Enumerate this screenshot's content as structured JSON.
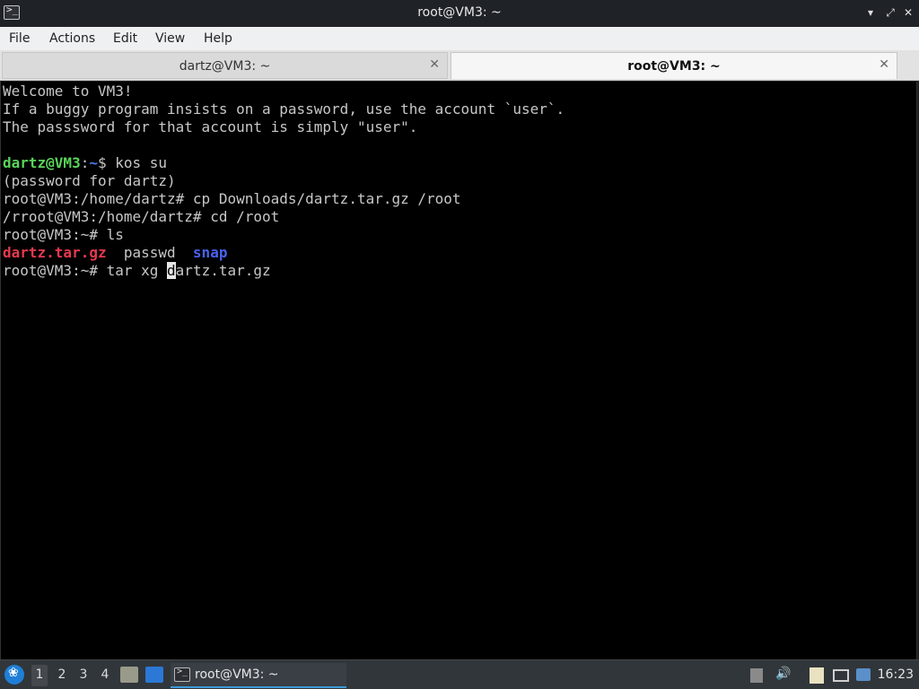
{
  "window": {
    "title": "root@VM3: ~",
    "icon": "terminal-icon",
    "controls": [
      "minimize-icon",
      "maximize-icon",
      "close-icon"
    ]
  },
  "menu": {
    "file": "File",
    "actions": "Actions",
    "edit": "Edit",
    "view": "View",
    "help": "Help"
  },
  "tabs": [
    {
      "label": "dartz@VM3: ~",
      "active": false
    },
    {
      "label": "root@VM3: ~",
      "active": true
    }
  ],
  "terminal": {
    "l1": "Welcome to VM3!",
    "l2": "If a buggy program insists on a password, use the account `user`.",
    "l3": "The passsword for that account is simply \"user\".",
    "l5_user": "dartz@VM3",
    "l5_colon": ":",
    "l5_path": "~",
    "l5_cmd": "$ kos su",
    "l6": "(password for dartz)",
    "l7": "root@VM3:/home/dartz# cp Downloads/dartz.tar.gz /root",
    "l8": "/rroot@VM3:/home/dartz# cd /root",
    "l9": "root@VM3:~# ls",
    "l10_file1": "dartz.tar.gz",
    "l10_sep1": "  ",
    "l10_file2": "passwd",
    "l10_sep2": "  ",
    "l10_file3": "snap",
    "l11_before": "root@VM3:~# tar xg ",
    "l11_cursor": "d",
    "l11_after": "artz.tar.gz"
  },
  "taskbar": {
    "workspaces": [
      "1",
      "2",
      "3",
      "4"
    ],
    "task_label": "root@VM3: ~",
    "clock": "16:23"
  },
  "colors": {
    "prompt_user": "#5ad35a",
    "prompt_path": "#4e7dea",
    "archive": "#e5394f",
    "directory": "#4863f0"
  }
}
